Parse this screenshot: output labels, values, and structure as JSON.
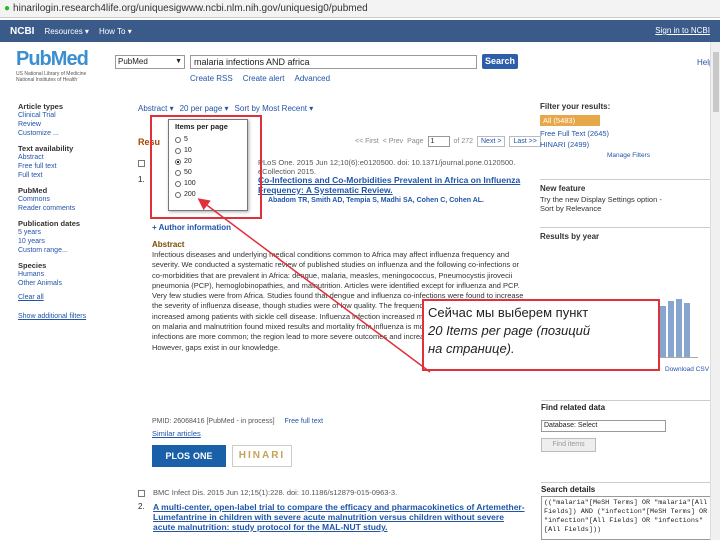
{
  "browser": {
    "url": "hinarilogin.research4life.org/uniquesigwww.ncbi.nlm.nih.gov/uniquesig0/pubmed"
  },
  "ncbi_bar": {
    "logo": "NCBI",
    "resources": "Resources ▾",
    "how_to": "How To ▾",
    "sign_in": "Sign in to NCBI"
  },
  "pubmed": {
    "logo_pub": "Pub",
    "logo_med": "Med",
    "sub1": "US National Library of Medicine",
    "sub2": "National Institutes of Health",
    "db": "PubMed",
    "query": "malaria infections AND africa",
    "search_label": "Search",
    "help": "Help",
    "links": [
      "Create RSS",
      "Create alert",
      "Advanced"
    ]
  },
  "left_filters": [
    {
      "title": "Article types",
      "items": [
        "Clinical Trial",
        "Review",
        "Customize ..."
      ]
    },
    {
      "title": "Text availability",
      "items": [
        "Abstract",
        "Free full text",
        "Full text"
      ]
    },
    {
      "title": "PubMed",
      "items": [
        "Commons",
        "Reader comments"
      ]
    },
    {
      "title": "Publication dates",
      "items": [
        "5 years",
        "10 years",
        "Custom range..."
      ]
    },
    {
      "title": "Species",
      "items": [
        "Humans",
        "Other Animals"
      ]
    }
  ],
  "left_links": [
    "Clear all",
    "Show additional filters"
  ],
  "toolbar": {
    "format": "Abstract ▾",
    "per_page": "20 per page ▾",
    "sort": "Sort by Most Recent ▾"
  },
  "results_label": "Resu",
  "pager": {
    "first": "<< First",
    "prev": "< Prev",
    "page_label": "Page",
    "page": "1",
    "of": "of 272",
    "next": "Next >",
    "last": "Last >>"
  },
  "dropdown": {
    "title": "Items per page",
    "options": [
      {
        "label": "5",
        "selected": false
      },
      {
        "label": "10",
        "selected": false
      },
      {
        "label": "20",
        "selected": true
      },
      {
        "label": "50",
        "selected": false
      },
      {
        "label": "100",
        "selected": false
      },
      {
        "label": "200",
        "selected": false
      }
    ]
  },
  "result1": {
    "num": "1.",
    "meta": "PLoS One. 2015 Jun 12;10(6):e0120500. doi: 10.1371/journal.pone.0120500. eCollection 2015.",
    "title": "Co-Infections and Co-Morbidities Prevalent in Africa on Influenza Frequency: A Systematic Review.",
    "authors": "Abadom TR, Smith AD, Tempia S, Madhi SA, Cohen C, Cohen AL."
  },
  "author_info": "+ Author information",
  "abstract_head": "Abstract",
  "abstract_text": "Infectious diseases and underlying medical conditions common to Africa may affect influenza frequency and severity. We conducted a systematic review of published studies on influenza and the following co-infections or co-morbidities that are prevalent in Africa: dengue, malaria, measles, meningococcus, Pneumocystis jirovecii pneumonia (PCP), hemoglobinopathies, and malnutrition. Articles were identified except for influenza and PCP. Very few studies were from Africa. Studies found that dengue and influenza co-infections were found to increase the severity of influenza disease, though studies were of low quality. The frequency of influenza and measles increased among patients with sickle cell disease. Influenza infection increased meningococcal disease. Studies on malaria and malnutrition found mixed results and mortality from influenza is more common in Africa because infections are more common; the region lead to more severe outcomes and increase the influenza burden. However, gaps exist in our knowledge.",
  "pmid_line": "PMID: 26068416 [PubMed - in process]",
  "free_full_text": "Free full text",
  "similar_link": "Similar articles",
  "plos_label": "PLOS",
  "plos_one": "ONE",
  "hinari_label": "HINARI",
  "result2": {
    "num": "2.",
    "meta": "BMC Infect Dis. 2015 Jun 12;15(1):228. doi: 10.1186/s12879-015-0963-3.",
    "title": "A multi-center, open-label trial to compare the efficacy and pharmacokinetics of Artemether-Lumefantrine in children with severe acute malnutrition versus children without severe acute malnutrition: study protocol for the MAL-NUT study."
  },
  "right_panel": {
    "filter_title": "Filter your results:",
    "all": "All (5483)",
    "free_full": "Free Full Text (2645)",
    "hinari": "HINARI (2499)",
    "manage": "Manage Filters",
    "new_feature_title": "New feature",
    "new_feature_text": "Try the new Display Settings option - Sort by Relevance",
    "results_by_year": "Results by year",
    "download_csv": "Download CSV",
    "related_title": "Find related data",
    "database_label": "Database:",
    "database_value": "Select",
    "find_items": "Find items",
    "search_details_title": "Search details",
    "search_details": "((\"malaria\"[MeSH Terms] OR \"malaria\"[All Fields]) AND (\"infection\"[MeSH Terms] OR \"infection\"[All Fields] OR \"infections\"[All Fields]))"
  },
  "year_chart": {
    "type": "bar",
    "values": [
      3,
      4,
      5,
      6,
      8,
      10,
      13,
      16,
      20,
      26,
      30,
      34,
      38,
      42,
      46,
      50,
      52,
      48
    ]
  },
  "callout": {
    "line1": "Сейчас мы выберем пункт",
    "line2": "20 Items per page (позиций",
    "line3": "на странице)."
  },
  "colors": {
    "ncbi_bar": "#3a5a8a",
    "link": "#2155a8",
    "highlight": "#e0303a",
    "filter_all": "#e7a84a"
  }
}
